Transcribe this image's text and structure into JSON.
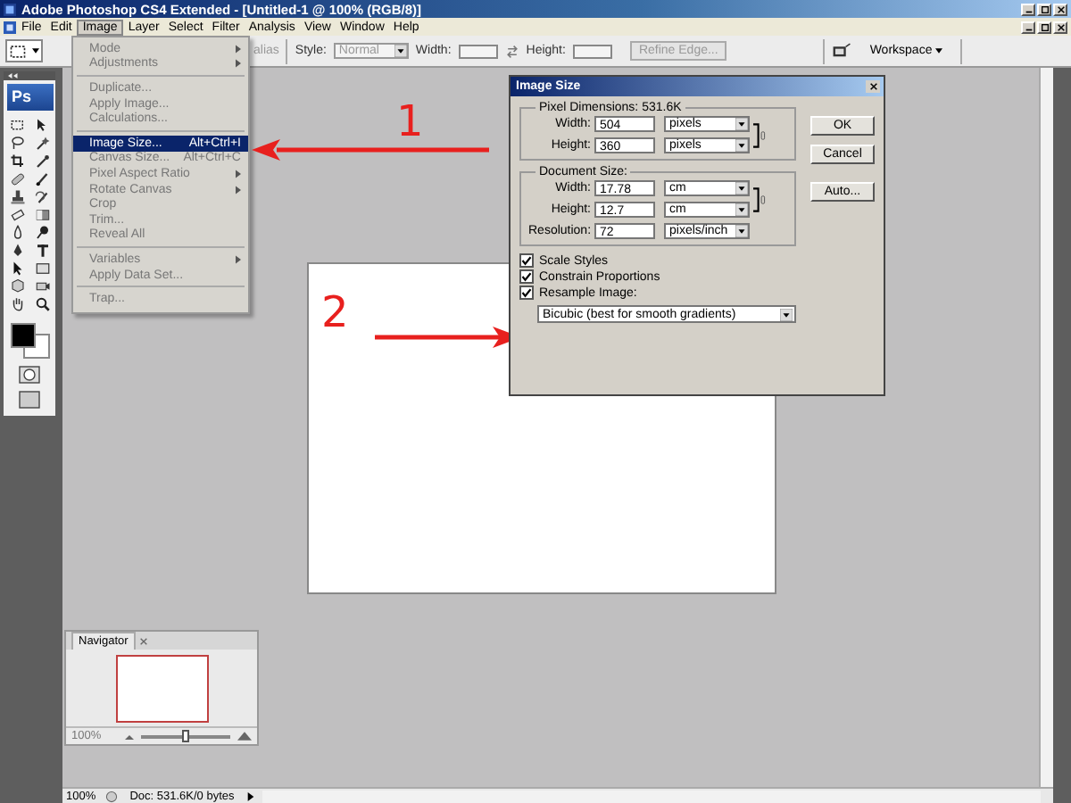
{
  "window": {
    "title": "Adobe Photoshop CS4 Extended - [Untitled-1 @ 100% (RGB/8)]"
  },
  "menu_bar": [
    {
      "label": "File",
      "selected": false
    },
    {
      "label": "Edit",
      "selected": false
    },
    {
      "label": "Image",
      "selected": true
    },
    {
      "label": "Layer",
      "selected": false
    },
    {
      "label": "Select",
      "selected": false
    },
    {
      "label": "Filter",
      "selected": false
    },
    {
      "label": "Analysis",
      "selected": false
    },
    {
      "label": "View",
      "selected": false
    },
    {
      "label": "Window",
      "selected": false
    },
    {
      "label": "Help",
      "selected": false
    }
  ],
  "options_bar": {
    "covered_text": "alias",
    "style_label": "Style:",
    "style_value": "Normal",
    "width_label": "Width:",
    "height_label": "Height:",
    "refine_button": "Refine Edge...",
    "workspace_button": "Workspace"
  },
  "toolbox": {
    "logo": "Ps"
  },
  "image_menu": {
    "groups": [
      [
        {
          "label": "Mode",
          "submenu": true,
          "selected": false
        },
        {
          "label": "Adjustments",
          "submenu": true,
          "selected": false
        }
      ],
      [
        {
          "label": "Duplicate...",
          "submenu": false,
          "selected": false
        },
        {
          "label": "Apply Image...",
          "submenu": false,
          "selected": false
        },
        {
          "label": "Calculations...",
          "submenu": false,
          "selected": false
        }
      ],
      [
        {
          "label": "Image Size...",
          "shortcut": "Alt+Ctrl+I",
          "submenu": false,
          "selected": true
        },
        {
          "label": "Canvas Size...",
          "shortcut": "Alt+Ctrl+C",
          "submenu": false,
          "selected": false
        },
        {
          "label": "Pixel Aspect Ratio",
          "submenu": true,
          "selected": false
        },
        {
          "label": "Rotate Canvas",
          "submenu": true,
          "selected": false
        },
        {
          "label": "Crop",
          "submenu": false,
          "selected": false
        },
        {
          "label": "Trim...",
          "submenu": false,
          "selected": false
        },
        {
          "label": "Reveal All",
          "submenu": false,
          "selected": false
        }
      ],
      [
        {
          "label": "Variables",
          "submenu": true,
          "selected": false
        },
        {
          "label": "Apply Data Set...",
          "submenu": false,
          "selected": false
        }
      ],
      [
        {
          "label": "Trap...",
          "submenu": false,
          "selected": false
        }
      ]
    ]
  },
  "annotations": [
    {
      "label": "1"
    },
    {
      "label": "2"
    }
  ],
  "dialog": {
    "title": "Image Size",
    "pixel_dimensions": {
      "legend": "Pixel Dimensions:",
      "size": "531.6K",
      "linked": true,
      "rows": [
        {
          "label": "Width:",
          "value": "504",
          "unit": "pixels"
        },
        {
          "label": "Height:",
          "value": "360",
          "unit": "pixels"
        }
      ]
    },
    "document_size": {
      "legend": "Document Size:",
      "linked": true,
      "rows": [
        {
          "label": "Width:",
          "value": "17.78",
          "unit": "cm"
        },
        {
          "label": "Height:",
          "value": "12.7",
          "unit": "cm"
        }
      ],
      "resolution": {
        "label": "Resolution:",
        "value": "72",
        "unit": "pixels/inch"
      }
    },
    "checkboxes": [
      {
        "label": "Scale Styles",
        "checked": true
      },
      {
        "label": "Constrain Proportions",
        "checked": true
      },
      {
        "label": "Resample Image:",
        "checked": true
      }
    ],
    "resample_method": "Bicubic (best for smooth gradients)",
    "buttons": [
      "OK",
      "Cancel",
      "Auto..."
    ]
  },
  "navigator": {
    "tab": "Navigator",
    "zoom": "100%",
    "level": 0.5
  },
  "status_bar": {
    "zoom": "100%",
    "doc_info": "Doc: 531.6K/0 bytes"
  }
}
